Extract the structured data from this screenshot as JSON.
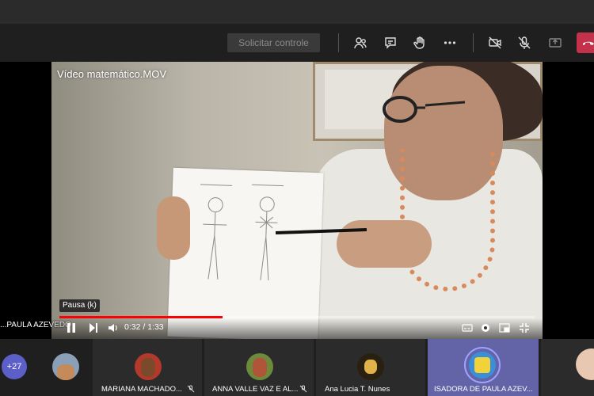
{
  "toolbar": {
    "request_control_label": "Solicitar controle",
    "icons": [
      "participants-icon",
      "chat-icon",
      "raise-hand-icon",
      "more-icon",
      "camera-off-icon",
      "mic-off-icon",
      "share-icon",
      "hang-up-icon"
    ]
  },
  "video": {
    "title": "Vídeo matemático.MOV",
    "tooltip": "Pausa (k)",
    "time": "0:32 / 1:33",
    "progress": 0.344,
    "buffered": 0.35
  },
  "presenter": {
    "name": "PAULA AZEVEDO"
  },
  "participants": {
    "overflow_count": "+27",
    "tiles": [
      {
        "name": "MARIANA MACHADO...",
        "muted": true
      },
      {
        "name": "ANNA VALLE VAZ E AL...",
        "muted": true
      },
      {
        "name": "Ana Lucia T. Nunes",
        "muted": false
      },
      {
        "name": "ISADORA DE PAULA AZEV...",
        "muted": false,
        "active": true
      }
    ]
  },
  "colors": {
    "accent": "#6264a7",
    "hangup": "#c4314b",
    "progress": "#ff0000",
    "badge": "#5b5fc7"
  }
}
